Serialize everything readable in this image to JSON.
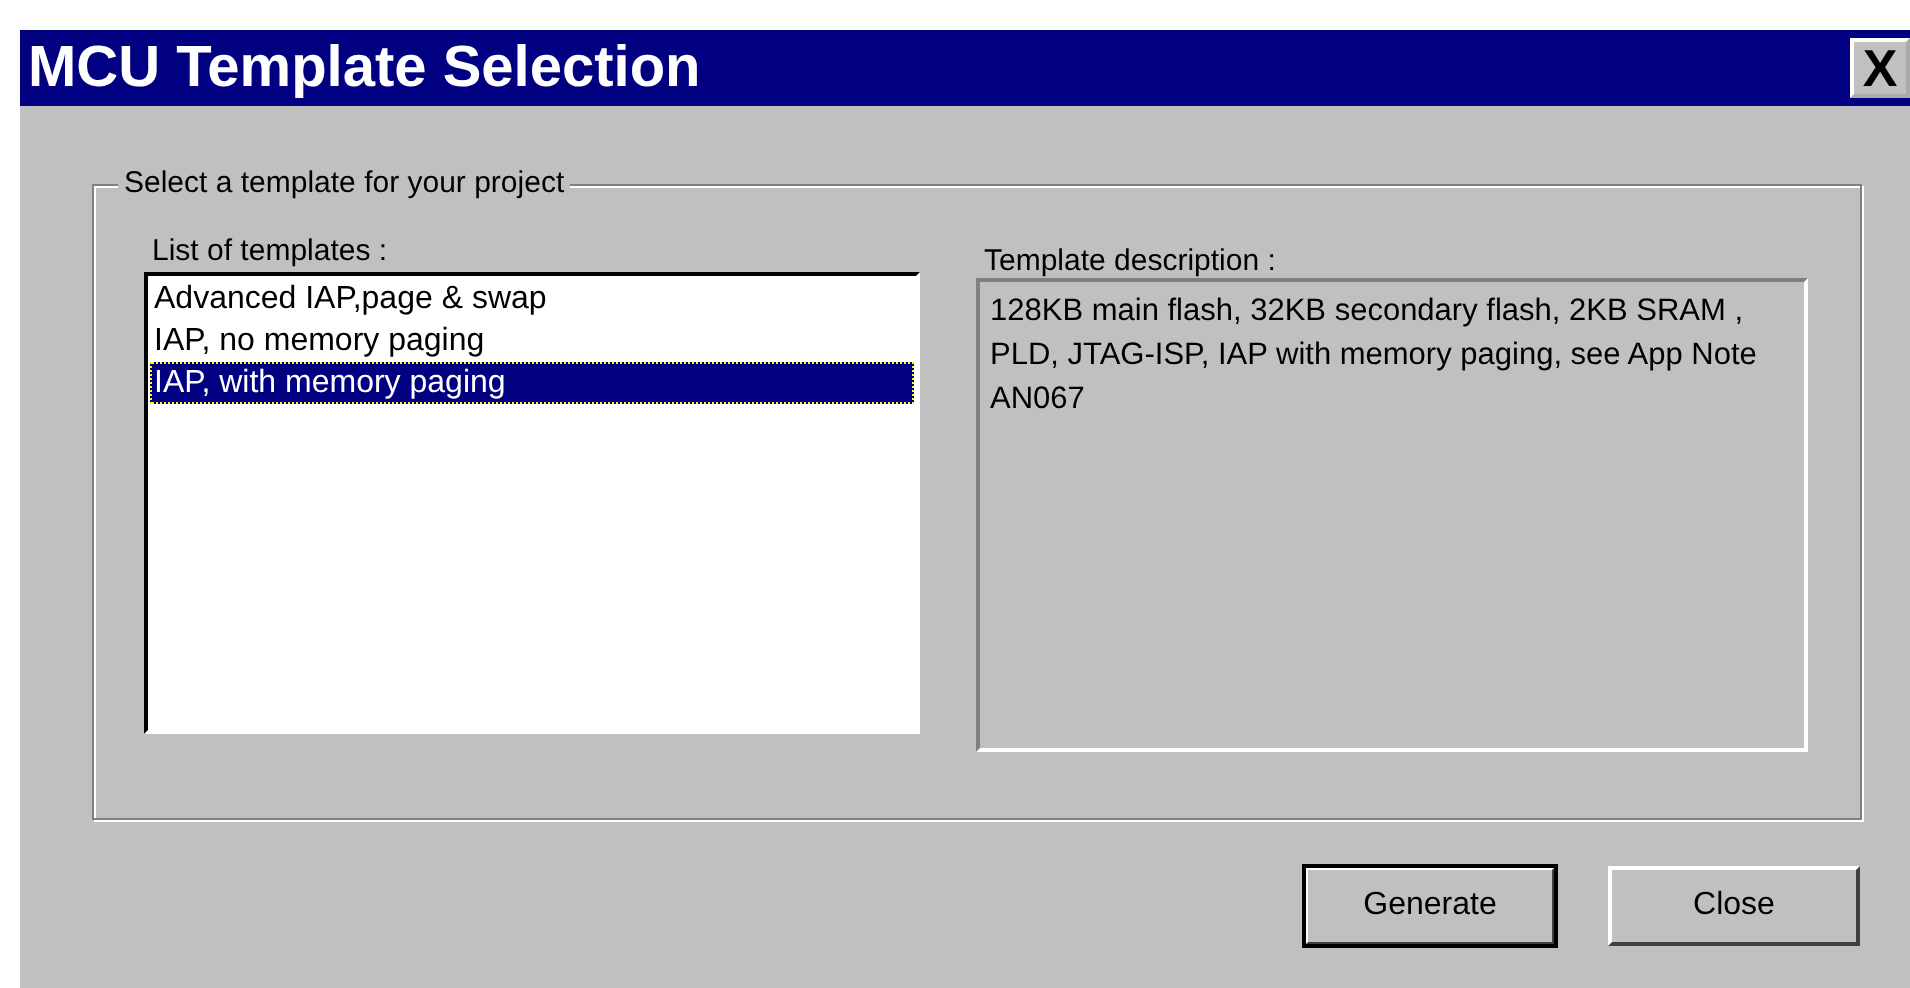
{
  "window": {
    "title": "MCU Template Selection",
    "close": "X"
  },
  "group": {
    "legend": "Select a template for your project",
    "templates": {
      "label": "List of templates :",
      "items": [
        {
          "text": "Advanced IAP,page & swap",
          "selected": false
        },
        {
          "text": "IAP, no memory paging",
          "selected": false
        },
        {
          "text": "IAP, with memory paging",
          "selected": true
        }
      ]
    },
    "description": {
      "label": "Template description :",
      "text": "128KB main flash, 32KB secondary flash, 2KB SRAM , PLD, JTAG-ISP, IAP with memory paging, see App Note AN067"
    }
  },
  "buttons": [
    {
      "label": "Generate",
      "default": true
    },
    {
      "label": "Close",
      "default": false
    }
  ]
}
